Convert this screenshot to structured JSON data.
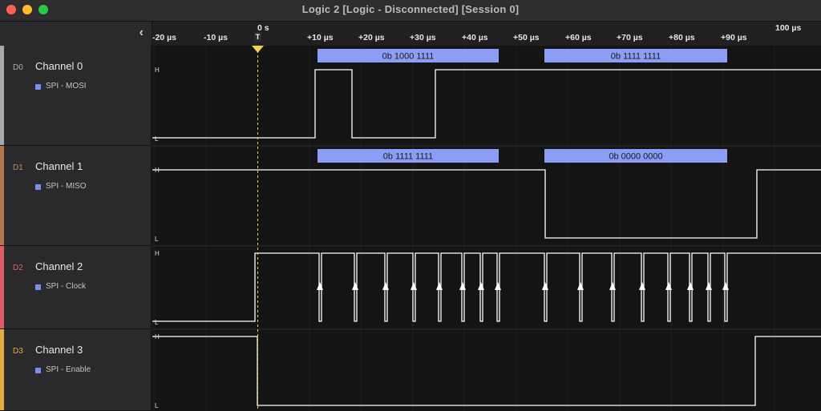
{
  "window": {
    "title": "Logic 2 [Logic - Disconnected] [Session 0]",
    "controls": [
      {
        "name": "close",
        "color": "#ff5f57"
      },
      {
        "name": "minimize",
        "color": "#febc2e"
      },
      {
        "name": "zoom",
        "color": "#28c840"
      }
    ]
  },
  "sidebar": {
    "collapse_icon": "‹"
  },
  "timeline": {
    "origin_label": "0 s",
    "trigger_marker": "T",
    "far_label": "100 µs",
    "ticks": [
      "-20 µs",
      "-10 µs",
      "+10 µs",
      "+20 µs",
      "+30 µs",
      "+40 µs",
      "+50 µs",
      "+60 µs",
      "+70 µs",
      "+80 µs",
      "+90 µs"
    ]
  },
  "channels": [
    {
      "id": "D0",
      "name": "Channel 0",
      "analyzer": "SPI - MOSI",
      "color": "#a9a9a9",
      "label_color": "#b0b0b0",
      "high_label": "H",
      "low_label": "L",
      "frames": [
        "0b 1000 1111",
        "0b 1111 1111"
      ]
    },
    {
      "id": "D1",
      "name": "Channel 1",
      "analyzer": "SPI - MISO",
      "color": "#b07a4e",
      "label_color": "#c08a5c",
      "high_label": "H",
      "low_label": "L",
      "frames": [
        "0b 1111 1111",
        "0b 0000 0000"
      ]
    },
    {
      "id": "D2",
      "name": "Channel 2",
      "analyzer": "SPI - Clock",
      "color": "#e05a6b",
      "label_color": "#e06272",
      "high_label": "H",
      "low_label": "L"
    },
    {
      "id": "D3",
      "name": "Channel 3",
      "analyzer": "SPI - Enable",
      "color": "#e3ad3b",
      "label_color": "#e3ad3b",
      "high_label": "H",
      "low_label": "L"
    }
  ],
  "colors": {
    "analyzer": "#7b8ff2",
    "frame_bubble": "#8c9df5",
    "trigger": "#f5d24b",
    "waveform": "#ffffff"
  }
}
